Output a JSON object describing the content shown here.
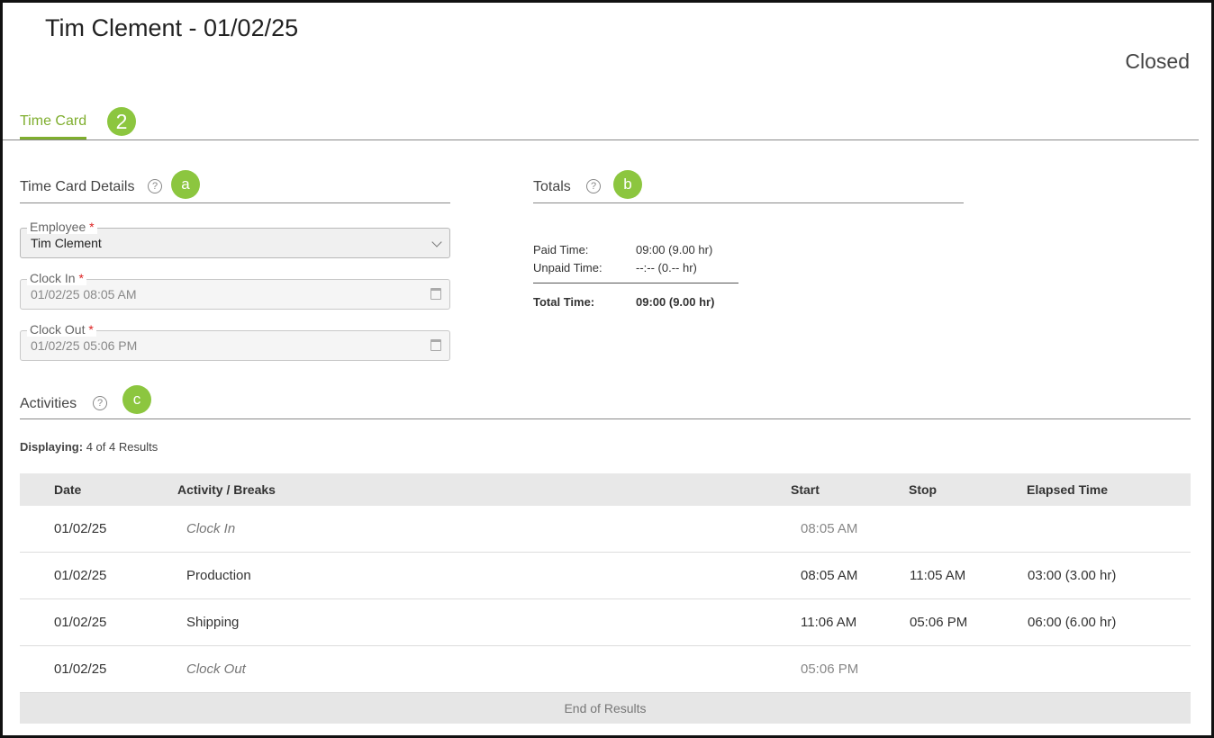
{
  "header": {
    "title": "Tim Clement - 01/02/25",
    "status": "Closed"
  },
  "tabs": [
    {
      "label": "Time Card",
      "active": true
    }
  ],
  "badges": {
    "tab": "2",
    "details": "a",
    "totals": "b",
    "activities": "c"
  },
  "details": {
    "title": "Time Card Details",
    "employee": {
      "label": "Employee",
      "value": "Tim Clement"
    },
    "clock_in": {
      "label": "Clock In",
      "value": "01/02/25 08:05 AM"
    },
    "clock_out": {
      "label": "Clock Out",
      "value": "01/02/25 05:06 PM"
    },
    "required_mark": "*"
  },
  "totals": {
    "title": "Totals",
    "paid_label": "Paid Time:",
    "paid_value": "09:00 (9.00 hr)",
    "unpaid_label": "Unpaid Time:",
    "unpaid_value": "--:-- (0.-- hr)",
    "total_label": "Total Time:",
    "total_value": "09:00 (9.00 hr)"
  },
  "activities": {
    "title": "Activities",
    "displaying_label": "Displaying:",
    "displaying_value": "4 of 4 Results",
    "columns": [
      "Date",
      "Activity / Breaks",
      "Start",
      "Stop",
      "Elapsed Time"
    ],
    "rows": [
      {
        "date": "01/02/25",
        "activity": "Clock In",
        "start": "08:05 AM",
        "stop": "",
        "elapsed": ""
      },
      {
        "date": "01/02/25",
        "activity": "Production",
        "start": "08:05 AM",
        "stop": "11:05 AM",
        "elapsed": "03:00 (3.00 hr)"
      },
      {
        "date": "01/02/25",
        "activity": "Shipping",
        "start": "11:06 AM",
        "stop": "05:06 PM",
        "elapsed": "06:00 (6.00 hr)"
      },
      {
        "date": "01/02/25",
        "activity": "Clock Out",
        "start": "05:06 PM",
        "stop": "",
        "elapsed": ""
      }
    ],
    "footer": "End of Results"
  },
  "colors": {
    "accent": "#7fae2e",
    "badge": "#8cc63f",
    "required": "#dd2222"
  },
  "icons": {
    "help": "question-circle-icon",
    "dropdown": "chevron-down-icon",
    "calendar": "calendar-icon"
  }
}
